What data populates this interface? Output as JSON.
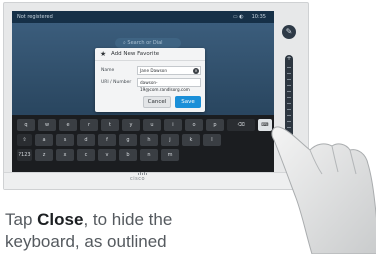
{
  "topbar": {
    "left_text": "Not registered",
    "right_items": [
      "10:35"
    ]
  },
  "search": {
    "placeholder": "Search or Dial"
  },
  "dialog": {
    "title": "Add New Favorite",
    "name_label": "Name",
    "name_value": "Jane Dawson",
    "uri_label": "URI / Number",
    "uri_value": "dawson-19@com.randlsorg.com",
    "cancel_label": "Cancel",
    "save_label": "Save"
  },
  "keyboard": {
    "row1": [
      "q",
      "w",
      "e",
      "r",
      "t",
      "y",
      "u",
      "i",
      "o",
      "p"
    ],
    "row2": [
      "a",
      "s",
      "d",
      "f",
      "g",
      "h",
      "j",
      "k",
      "l"
    ],
    "row3": [
      "z",
      "x",
      "c",
      "v",
      "b",
      "n",
      "m"
    ],
    "shift_label": "⇧",
    "numbers_label": "?123",
    "backspace_label": "⌫",
    "hide_label": "⌨"
  },
  "brand": {
    "text": "cisco"
  },
  "caption": {
    "prefix": "Tap ",
    "emphasis": "Close",
    "suffix": ", to hide the",
    "line2": "keyboard, as outlined"
  }
}
